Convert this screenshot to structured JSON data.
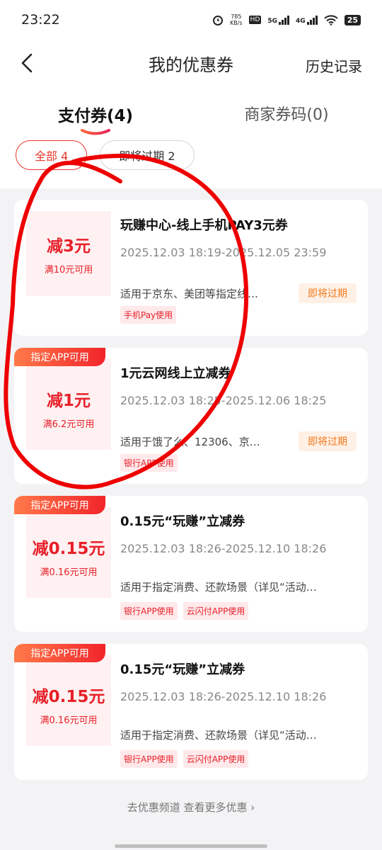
{
  "status": {
    "time": "23:22",
    "net_speed_top": "785",
    "net_speed_unit": "KB/s",
    "hd_label": "HD",
    "net1": "5G",
    "net2": "4G",
    "battery": "25"
  },
  "header": {
    "title": "我的优惠券",
    "history": "历史记录"
  },
  "tabs": [
    {
      "label": "支付券(4)",
      "active": true
    },
    {
      "label": "商家券码(0)",
      "active": false
    }
  ],
  "filters": [
    {
      "label": "全部 4",
      "active": true
    },
    {
      "label": "即将过期 2",
      "active": false
    }
  ],
  "coupons": [
    {
      "ribbon": "",
      "amount": "减3元",
      "condition": "满10元可用",
      "name": "玩赚中心-线上手机PAY3元券",
      "date": "2025.12.03 18:19-2025.12.05 23:59",
      "scope": "适用于京东、美团等指定线…",
      "badge": "即将过期",
      "tags": [
        "手机Pay使用"
      ]
    },
    {
      "ribbon": "指定APP可用",
      "amount": "减1元",
      "condition": "满6.2元可用",
      "name": "1元云网线上立减券",
      "date": "2025.12.03 18:25-2025.12.06 18:25",
      "scope": "适用于饿了么、12306、京…",
      "badge": "即将过期",
      "tags": [
        "银行APP使用"
      ]
    },
    {
      "ribbon": "指定APP可用",
      "amount": "减0.15元",
      "condition": "满0.16元可用",
      "name": "0.15元“玩赚”立减券",
      "date": "2025.12.03 18:26-2025.12.10 18:26",
      "scope": "适用于指定消费、还款场景（详见“活动…",
      "badge": "",
      "tags": [
        "银行APP使用",
        "云闪付APP使用"
      ]
    },
    {
      "ribbon": "指定APP可用",
      "amount": "减0.15元",
      "condition": "满0.16元可用",
      "name": "0.15元“玩赚”立减券",
      "date": "2025.12.03 18:26-2025.12.10 18:26",
      "scope": "适用于指定消费、还款场景（详见“活动…",
      "badge": "",
      "tags": [
        "银行APP使用",
        "云闪付APP使用"
      ]
    }
  ],
  "footer": {
    "link": "去优惠频道 查看更多优惠"
  },
  "colors": {
    "accent": "#e8202a",
    "expire": "#f07a1e",
    "annotation": "#ee0000"
  }
}
